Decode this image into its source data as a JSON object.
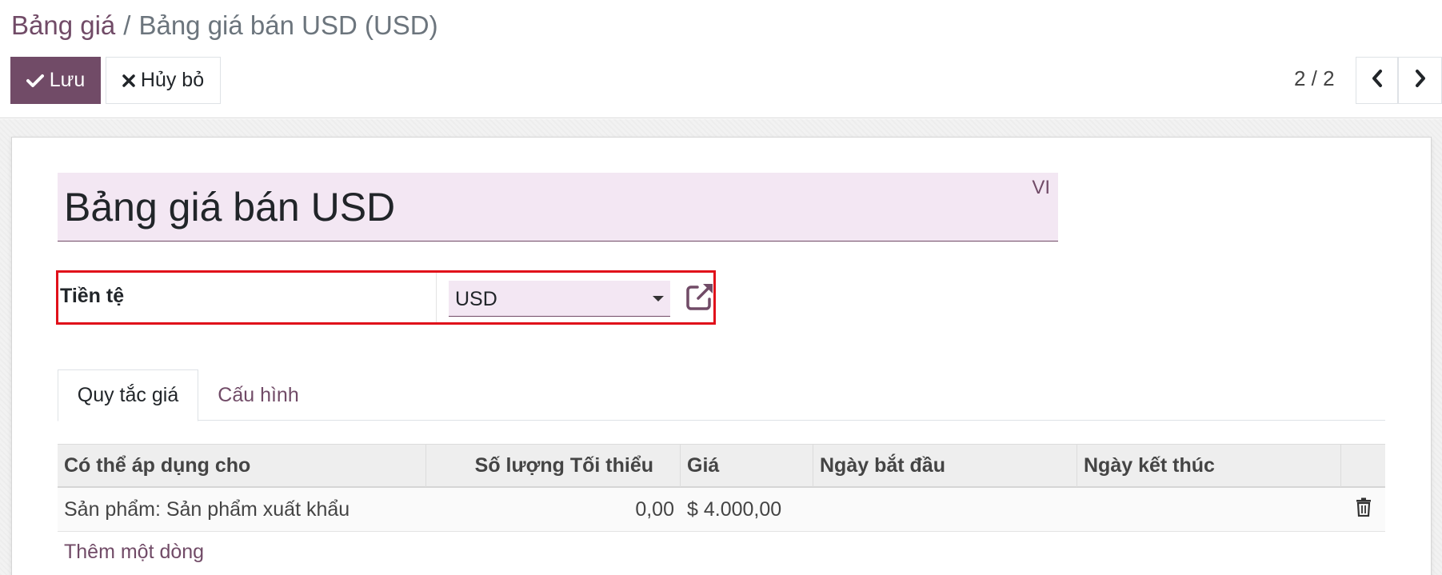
{
  "breadcrumb": {
    "parent": "Bảng giá",
    "separator": "/",
    "current": "Bảng giá bán USD (USD)"
  },
  "toolbar": {
    "save_label": "Lưu",
    "discard_label": "Hủy bỏ",
    "save_icon": "check-icon",
    "discard_icon": "close-icon"
  },
  "pager": {
    "value": "2 / 2"
  },
  "form": {
    "name": "Bảng giá bán USD",
    "lang": "VI",
    "currency_label": "Tiền tệ",
    "currency_value": "USD"
  },
  "tabs": [
    {
      "label": "Quy tắc giá",
      "active": true
    },
    {
      "label": "Cấu hình",
      "active": false
    }
  ],
  "table": {
    "columns": [
      "Có thể áp dụng cho",
      "Số lượng Tối thiểu",
      "Giá",
      "Ngày bắt đầu",
      "Ngày kết thúc"
    ],
    "rows": [
      {
        "applied_on": "Sản phẩm: Sản phẩm xuất khẩu",
        "min_qty": "0,00",
        "price": "$ 4.000,00",
        "date_start": "",
        "date_end": ""
      }
    ],
    "add_line_label": "Thêm một dòng"
  },
  "colors": {
    "brand": "#714b67",
    "field_bg": "#f3e7f3",
    "highlight_border": "#e0101a"
  }
}
